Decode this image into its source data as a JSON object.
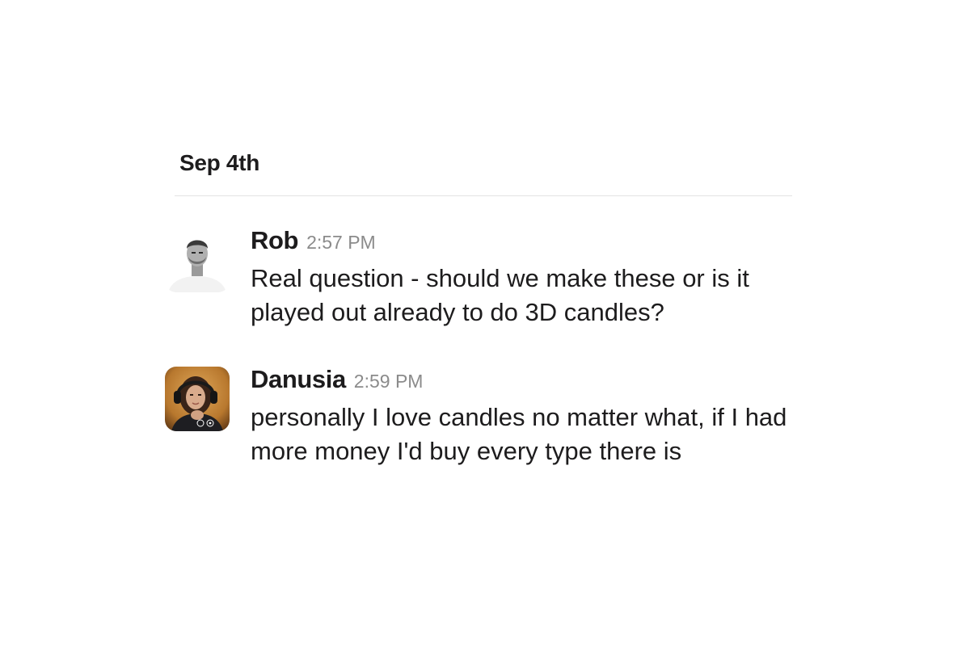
{
  "date_header": "Sep 4th",
  "messages": [
    {
      "author": "Rob",
      "time": "2:57 PM",
      "text": "Real question - should we make these or is it played out already to do 3D candles?",
      "avatar_icon": "user-photo-grayscale"
    },
    {
      "author": "Danusia",
      "time": "2:59 PM",
      "text": "personally I love candles no matter what, if I had more money I'd buy every type there is",
      "avatar_icon": "user-photo-headphones"
    }
  ],
  "colors": {
    "text": "#1d1c1d",
    "timestamp": "#8b8b8b",
    "divider": "#e3e3e3",
    "background": "#ffffff"
  }
}
